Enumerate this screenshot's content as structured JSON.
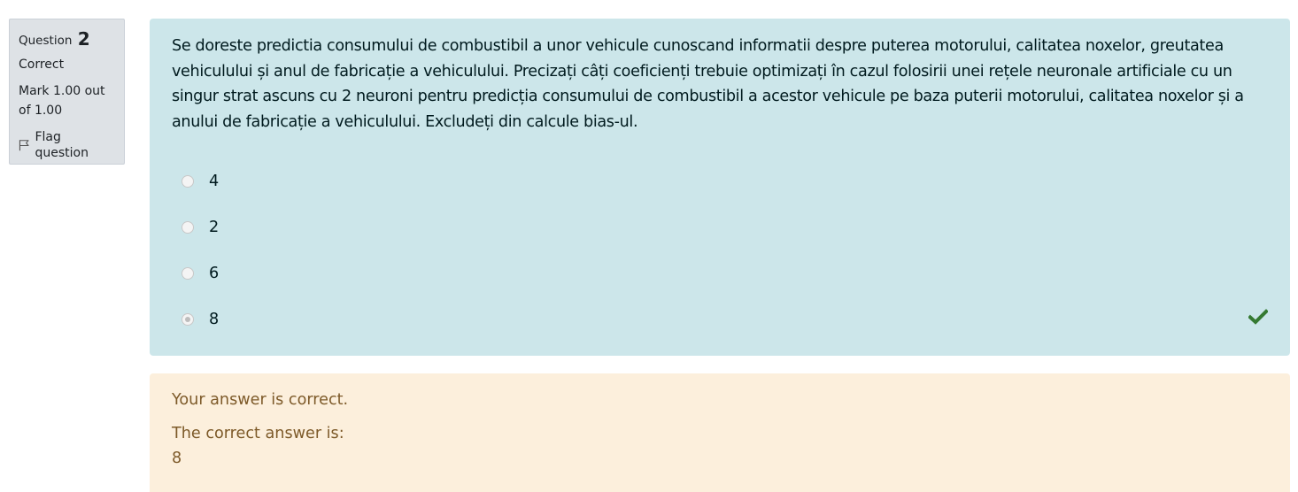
{
  "info": {
    "question_label": "Question",
    "question_number": "2",
    "state": "Correct",
    "grade": "Mark 1.00 out of 1.00",
    "flag_label": "Flag question"
  },
  "question": {
    "text": "Se doreste predictia consumului de combustibil a unor vehicule cunoscand informatii despre puterea motorului, calitatea noxelor, greutatea vehiculului și anul de fabricație a vehiculului. Precizați câți coeficienți trebuie optimizați în cazul folosirii unei rețele neuronale artificiale cu un singur strat ascuns cu 2 neuroni pentru predicția consumului de combustibil a acestor vehicule pe baza puterii motorului, calitatea noxelor și a anului de fabricație a vehiculului. Excludeți din calcule bias-ul.",
    "options": [
      {
        "label": "4",
        "selected": false
      },
      {
        "label": "2",
        "selected": false
      },
      {
        "label": "6",
        "selected": false
      },
      {
        "label": "8",
        "selected": true
      }
    ],
    "correct_icon": "checkmark-icon",
    "correct_color": "#357a32"
  },
  "outcome": {
    "feedback": "Your answer is correct.",
    "right_answer_label": "The correct answer is:",
    "right_answer_value": "8"
  },
  "colors": {
    "info_bg": "#dee2e6",
    "formulation_bg": "#cce6ea",
    "outcome_bg": "#fcefdc",
    "outcome_text": "#7d5a29"
  }
}
